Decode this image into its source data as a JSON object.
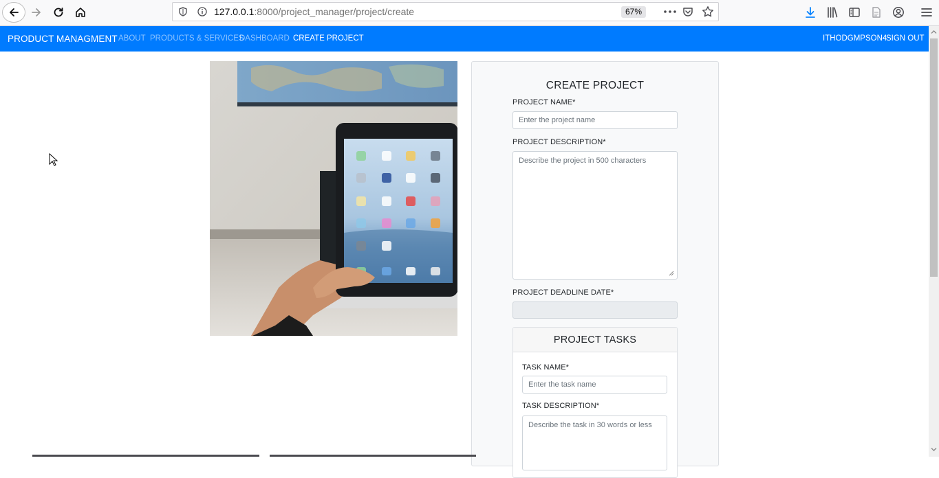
{
  "browser": {
    "url_host": "127.0.0.1",
    "url_rest": ":8000/project_manager/project/create",
    "zoom": "67%"
  },
  "navbar": {
    "brand": "PRODUCT MANAGMENT",
    "links": {
      "about": "ABOUT",
      "products": "PRODUCTS & SERVICES",
      "dashboard": "DASHBOARD",
      "create_project": "CREATE PROJECT"
    },
    "user": "ITHODGMPSON4",
    "sign_out": "SIGN OUT"
  },
  "form": {
    "title": "CREATE PROJECT",
    "project_name_label": "PROJECT NAME*",
    "project_name_placeholder": "Enter the project name",
    "project_description_label": "PROJECT DESCRIPTION*",
    "project_description_placeholder": "Describe the project in 500 characters",
    "deadline_label": "PROJECT DEADLINE DATE*",
    "tasks": {
      "title": "PROJECT TASKS",
      "task_name_label": "TASK NAME*",
      "task_name_placeholder": "Enter the task name",
      "task_description_label": "TASK DESCRIPTION*",
      "task_description_placeholder": "Describe the task in 30 words or less"
    }
  },
  "colors": {
    "navbar": "#007bff",
    "card_bg": "#f8f9fa",
    "download_icon": "#0a84ff"
  },
  "icons": [
    "back-icon",
    "forward-icon",
    "reload-icon",
    "home-icon",
    "shield-icon",
    "info-icon",
    "more-icon",
    "pocket-icon",
    "star-icon",
    "download-icon",
    "library-icon",
    "sidebar-icon",
    "reader-icon",
    "account-icon",
    "menu-icon"
  ]
}
